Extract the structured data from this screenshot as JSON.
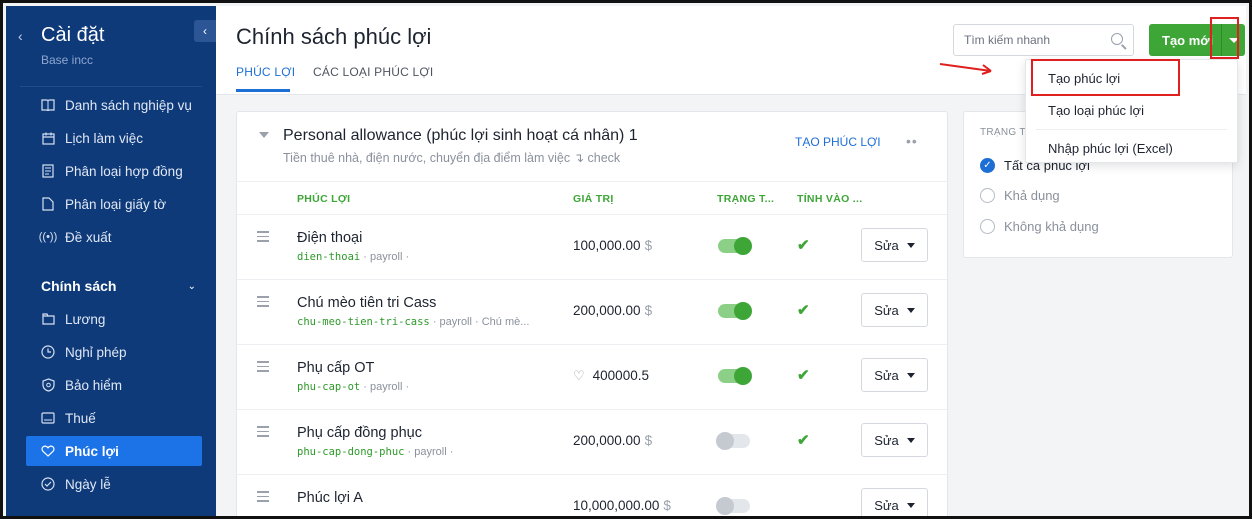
{
  "sidebar": {
    "title": "Cài đặt",
    "subtitle": "Base incc",
    "back_icon": "chevron-left-icon",
    "collapse_icon": "chevron-left-icon",
    "items_top": [
      {
        "label": "Danh sách nghiệp vụ",
        "icon": "book-icon"
      },
      {
        "label": "Lịch làm việc",
        "icon": "calendar-icon"
      },
      {
        "label": "Phân loại hợp đồng",
        "icon": "document-icon"
      },
      {
        "label": "Phân loại giấy tờ",
        "icon": "file-icon"
      },
      {
        "label": "Đề xuất",
        "icon": "broadcast-icon"
      }
    ],
    "section_label": "Chính sách",
    "items_policy": [
      {
        "label": "Lương",
        "icon": "folder-icon"
      },
      {
        "label": "Nghỉ phép",
        "icon": "clock-icon"
      },
      {
        "label": "Bảo hiểm",
        "icon": "shield-icon"
      },
      {
        "label": "Thuế",
        "icon": "receipt-icon"
      },
      {
        "label": "Phúc lợi",
        "icon": "heart-icon",
        "active": true
      },
      {
        "label": "Ngày lễ",
        "icon": "check-circle-icon"
      }
    ]
  },
  "header": {
    "title": "Chính sách phúc lợi",
    "tabs": [
      {
        "label": "PHÚC LỢI",
        "active": true
      },
      {
        "label": "CÁC LOẠI PHÚC LỢI",
        "active": false
      }
    ],
    "search_placeholder": "Tìm kiếm nhanh",
    "new_button_label": "Tạo mới"
  },
  "dropdown": {
    "items": [
      "Tạo phúc lợi",
      "Tạo loại phúc lợi",
      "Nhập phúc lợi (Excel)"
    ]
  },
  "group": {
    "title": "Personal allowance (phúc lợi sinh hoạt cá nhân) 1",
    "description": "Tiền thuê nhà, điện nước, chuyển địa điểm làm việc ↴ check",
    "create_link": "TẠO PHÚC LỢI",
    "columns": [
      "PHÚC LỢI",
      "GIÁ TRỊ",
      "TRẠNG T...",
      "TÍNH VÀO ..."
    ],
    "rows": [
      {
        "name": "Điện thoại",
        "code": "dien-thoai",
        "meta": " · payroll ·",
        "value": "100,000.00",
        "currency": "$",
        "heart": false,
        "enabled": true,
        "included": true,
        "edit": "Sửa"
      },
      {
        "name": "Chú mèo tiên tri Cass",
        "code": "chu-meo-tien-tri-cass",
        "meta": " · payroll · Chú mè...",
        "value": "200,000.00",
        "currency": "$",
        "heart": false,
        "enabled": true,
        "included": true,
        "edit": "Sửa"
      },
      {
        "name": "Phụ cấp OT",
        "code": "phu-cap-ot",
        "meta": " · payroll ·",
        "value": "400000.5",
        "currency": "",
        "heart": true,
        "enabled": true,
        "included": true,
        "edit": "Sửa"
      },
      {
        "name": "Phụ cấp đồng phục",
        "code": "phu-cap-dong-phuc",
        "meta": " · payroll ·",
        "value": "200,000.00",
        "currency": "$",
        "heart": false,
        "enabled": false,
        "included": true,
        "edit": "Sửa"
      },
      {
        "name": "Phúc lợi A",
        "code": "",
        "meta": "",
        "value": "10,000,000.00",
        "currency": "$",
        "heart": false,
        "enabled": false,
        "included": false,
        "edit": "Sửa"
      }
    ]
  },
  "filter": {
    "title": "TRẠNG TH",
    "options": [
      {
        "label": "Tất cả phúc lợi",
        "selected": true
      },
      {
        "label": "Khả dụng",
        "selected": false
      },
      {
        "label": "Không khả dụng",
        "selected": false
      }
    ]
  },
  "colors": {
    "sidebar_bg": "#0e3a7a",
    "active_item": "#1c73e8",
    "primary_green": "#3da637",
    "link_blue": "#1d6fd6",
    "annotation_red": "#e0201e"
  }
}
